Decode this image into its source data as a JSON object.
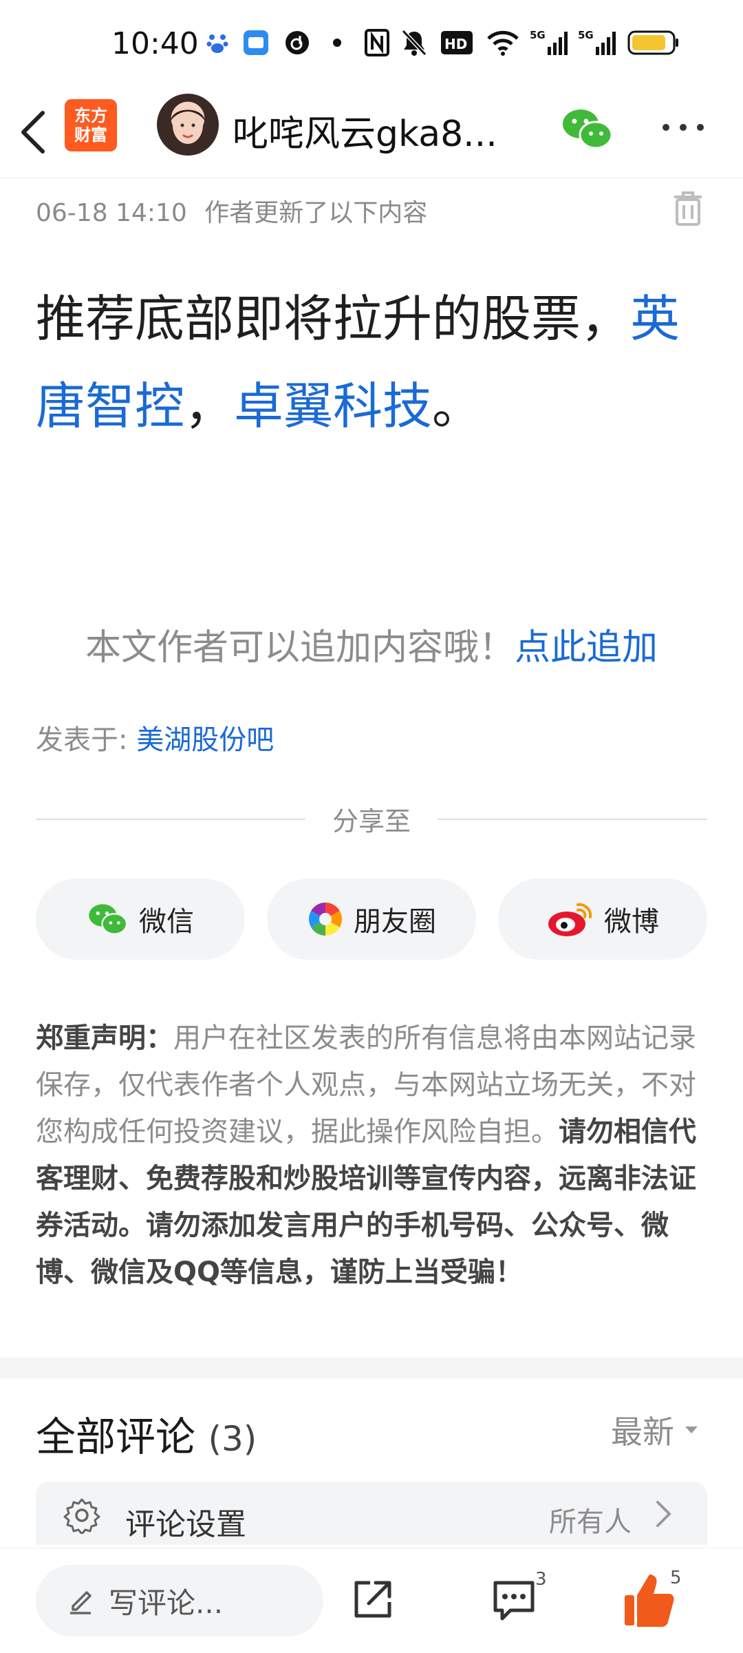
{
  "status_bar": {
    "time": "10:40",
    "network1": "5G",
    "network2": "5G",
    "hd_label": "HD"
  },
  "header": {
    "brand_logo_line1": "东方",
    "brand_logo_line2": "财富",
    "author_name": "叱咤风云gka8..."
  },
  "post": {
    "update_time": "06-18 14:10",
    "update_text": "作者更新了以下内容",
    "body_prefix": "推荐底部即将拉升的股票，",
    "stock1": "英唐智控",
    "separator": "，",
    "stock2": "卓翼科技",
    "period": "。"
  },
  "append": {
    "prompt": "本文作者可以追加内容哦！",
    "link": "点此追加"
  },
  "posted_to": {
    "label": "发表于: ",
    "forum": "美湖股份吧"
  },
  "share": {
    "title": "分享至",
    "buttons": [
      {
        "label": "微信"
      },
      {
        "label": "朋友圈"
      },
      {
        "label": "微博"
      }
    ]
  },
  "disclaimer": {
    "heading": "郑重声明：",
    "normal": "用户在社区发表的所有信息将由本网站记录保存，仅代表作者个人观点，与本网站立场无关，不对您构成任何投资建议，据此操作风险自担。",
    "bold": "请勿相信代客理财、免费荐股和炒股培训等宣传内容，远离非法证券活动。请勿添加发言用户的手机号码、公众号、微博、微信及QQ等信息，谨防上当受骗！"
  },
  "comments": {
    "title": "全部评论",
    "count": "(3)",
    "sort_label": "最新",
    "settings_label": "评论设置",
    "settings_value": "所有人"
  },
  "bottom_bar": {
    "input_placeholder": "写评论...",
    "comment_badge": "3",
    "like_badge": "5"
  },
  "colors": {
    "link": "#1a6ad6",
    "brand": "#ff5a1f",
    "like": "#f05a1a",
    "wechat": "#3fba39"
  }
}
